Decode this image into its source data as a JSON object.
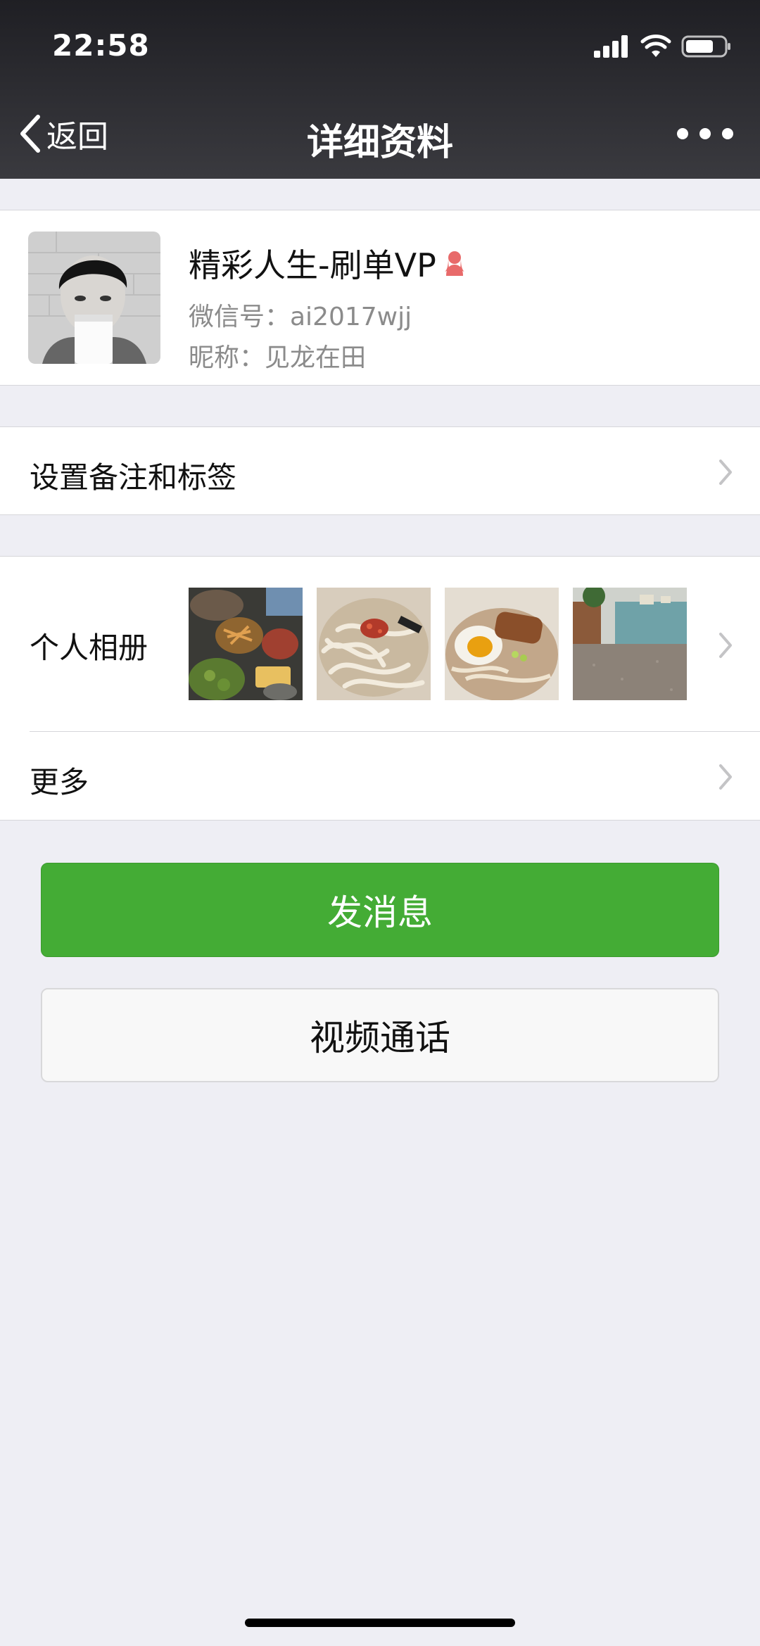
{
  "status_bar": {
    "time": "22:58"
  },
  "nav": {
    "back_label": "返回",
    "title": "详细资料"
  },
  "profile": {
    "name": "精彩人生-刷单VP",
    "wechat_id": "微信号：ai2017wjj",
    "nickname": "昵称：见龙在田"
  },
  "rows": {
    "remark": "设置备注和标签",
    "album": "个人相册",
    "more": "更多"
  },
  "buttons": {
    "send_message": "发消息",
    "video_call": "视频通话"
  },
  "colors": {
    "header_bg": "#2b2b30",
    "primary_green": "#44ac35",
    "gender_icon": "#e86a6a"
  }
}
